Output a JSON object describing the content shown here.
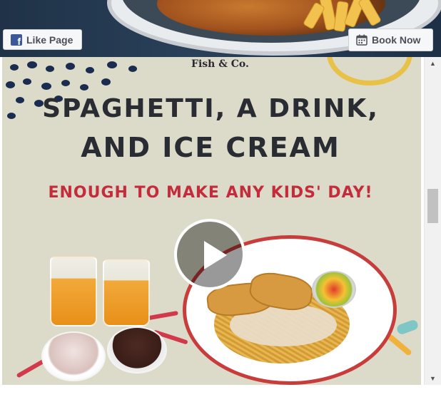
{
  "header": {
    "like_label": "Like Page",
    "book_label": "Book Now",
    "like_icon": "facebook-icon",
    "book_icon": "calendar-icon",
    "accent": "#3b5998"
  },
  "post": {
    "brand": "Fish & Co.",
    "headline_line1": "Spaghetti, a drink,",
    "headline_line2": "and ice cream",
    "subheadline": "Enough to make any kids' day!",
    "play_icon": "play-icon",
    "headline_color": "#2a2c33",
    "subheadline_color": "#c52c3b",
    "background_color": "#dcdac8"
  },
  "scrollbar": {
    "up_arrow": "▲",
    "down_arrow": "▼"
  }
}
